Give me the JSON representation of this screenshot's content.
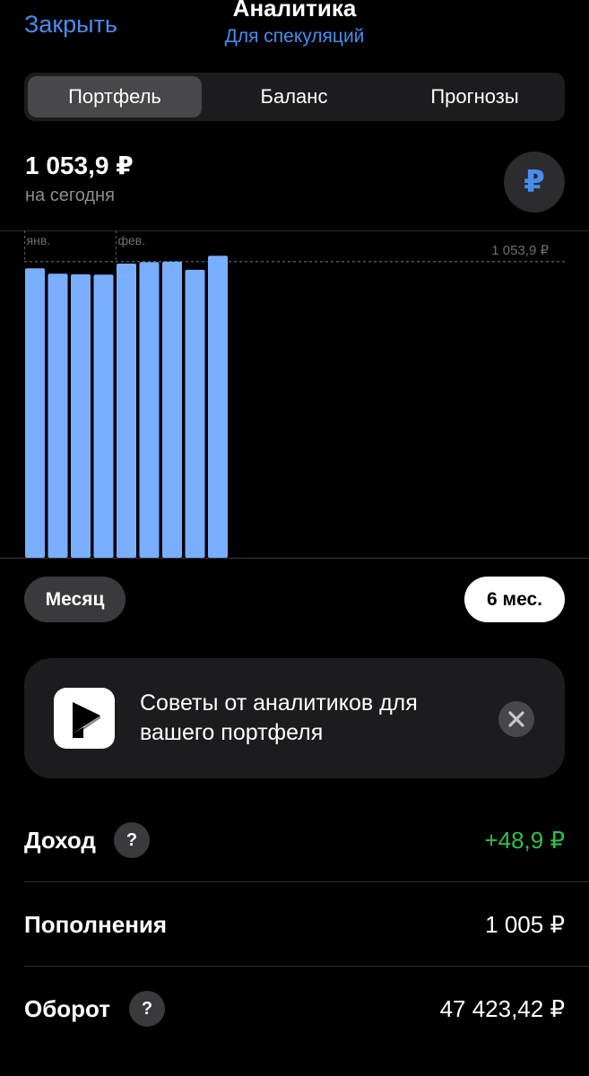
{
  "header": {
    "close_label": "Закрыть",
    "title": "Аналитика",
    "subtitle": "Для спекуляций"
  },
  "tabs": [
    {
      "label": "Портфель",
      "selected": true
    },
    {
      "label": "Баланс",
      "selected": false
    },
    {
      "label": "Прогнозы",
      "selected": false
    }
  ],
  "summary": {
    "amount": "1 053,9 ₽",
    "amount_caption": "на сегодня",
    "currency_symbol": "₽"
  },
  "chart_data": {
    "type": "bar",
    "month_labels": [
      {
        "label": "янв.",
        "bar_index": 0
      },
      {
        "label": "фев.",
        "bar_index": 4
      }
    ],
    "reference_label": "1 053,9 ₽",
    "reference_value": 1053.9,
    "values": [
      1030,
      1011,
      1009,
      1008,
      1047,
      1052,
      1054,
      1025,
      1075
    ],
    "ylim": [
      0,
      1165
    ],
    "bar_color": "#7aaeff"
  },
  "periods": [
    {
      "label": "Месяц",
      "selected": false
    },
    {
      "label": "6 мес.",
      "selected": true
    }
  ],
  "banner": {
    "text": "Советы от аналитиков для вашего портфеля"
  },
  "stats": [
    {
      "label": "Доход",
      "value": "+48,9 ₽",
      "has_help": true,
      "positive": true
    },
    {
      "label": "Пополнения",
      "value": "1 005 ₽",
      "has_help": false,
      "positive": false
    },
    {
      "label": "Оборот",
      "value": "47 423,42 ₽",
      "has_help": true,
      "positive": false
    }
  ],
  "colors": {
    "accent": "#4a8cf0",
    "positive": "#2fbf4a",
    "bar": "#7aaeff"
  }
}
